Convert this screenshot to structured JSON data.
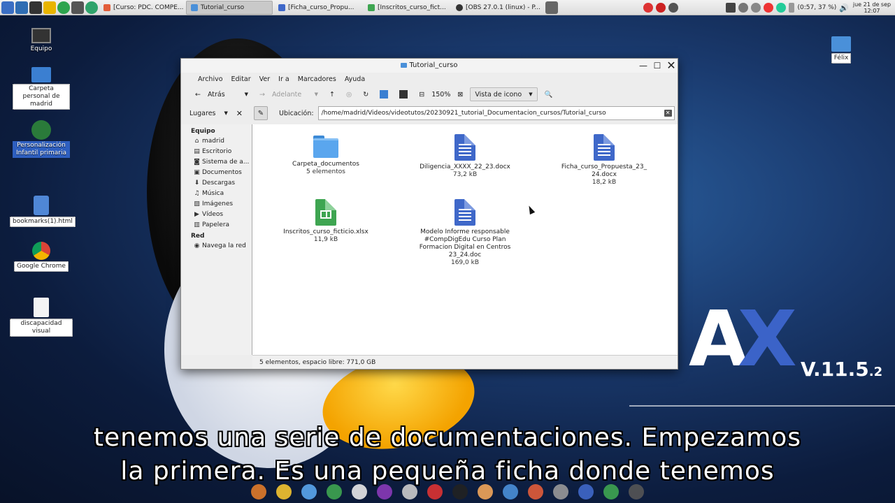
{
  "taskbar": {
    "tasks": [
      {
        "label": "[Curso: PDC. COMPE...",
        "active": false
      },
      {
        "label": "Tutorial_curso",
        "active": true
      },
      {
        "label": "[Ficha_curso_Propu...",
        "active": false
      },
      {
        "label": "[Inscritos_curso_fict...",
        "active": false
      },
      {
        "label": "[OBS 27.0.1 (linux) - P...",
        "active": false
      }
    ],
    "battery": "(0:57, 37 %)",
    "clock_date": "jue 21 de sep",
    "clock_time": "12:07"
  },
  "desktop": {
    "icons": [
      {
        "label": "Equipo"
      },
      {
        "label": "Carpeta personal de madrid"
      },
      {
        "label": "Personalización Infantil primaria"
      },
      {
        "label": "bookmarks(1).html"
      },
      {
        "label": "Google Chrome"
      },
      {
        "label": "discapacidad visual"
      },
      {
        "label": "Félix"
      }
    ]
  },
  "window": {
    "title": "Tutorial_curso",
    "menu": [
      "Archivo",
      "Editar",
      "Ver",
      "Ir a",
      "Marcadores",
      "Ayuda"
    ],
    "toolbar": {
      "back": "Atrás",
      "forward": "Adelante",
      "zoom": "150%",
      "view_mode": "Vista de icono"
    },
    "places_label": "Lugares",
    "location_label": "Ubicación:",
    "location_path": "/home/madrid/Videos/videotutos/20230921_tutorial_Documentacion_cursos/Tutorial_curso",
    "sidebar": {
      "sections": [
        {
          "title": "Equipo",
          "items": [
            {
              "icon": "home-icon",
              "glyph": "⌂",
              "label": "madrid"
            },
            {
              "icon": "desktop-icon",
              "glyph": "▤",
              "label": "Escritorio"
            },
            {
              "icon": "filesystem-icon",
              "glyph": "◙",
              "label": "Sistema de a..."
            },
            {
              "icon": "documents-icon",
              "glyph": "▣",
              "label": "Documentos"
            },
            {
              "icon": "download-icon",
              "glyph": "⬇",
              "label": "Descargas"
            },
            {
              "icon": "music-icon",
              "glyph": "♫",
              "label": "Música"
            },
            {
              "icon": "pictures-icon",
              "glyph": "▨",
              "label": "Imágenes"
            },
            {
              "icon": "videos-icon",
              "glyph": "▶",
              "label": "Vídeos"
            },
            {
              "icon": "trash-icon",
              "glyph": "▥",
              "label": "Papelera"
            }
          ]
        },
        {
          "title": "Red",
          "items": [
            {
              "icon": "network-icon",
              "glyph": "◉",
              "label": "Navega la red"
            }
          ]
        }
      ]
    },
    "files": [
      {
        "type": "folder",
        "name": "Carpeta_documentos",
        "size": "5 elementos"
      },
      {
        "type": "doc",
        "name": "Diligencia_XXXX_22_23.docx",
        "size": "73,2 kB"
      },
      {
        "type": "doc",
        "name": "Ficha_curso_Propuesta_23_ 24.docx",
        "size": "18,2 kB"
      },
      {
        "type": "xls",
        "name": "Inscritos_curso_ficticio.xlsx",
        "size": "11,9 kB"
      },
      {
        "type": "doc",
        "name": "Modelo Informe responsable #CompDigEdu Curso Plan Formacion Digital en Centros 23_24.doc",
        "size": "169,0 kB"
      }
    ],
    "status": "5 elementos, espacio libre: 771,0 GB"
  },
  "branding": {
    "letter_a": "A",
    "letter_x": "X",
    "version": "V.11.5",
    "version_minor": ".2"
  },
  "subtitles": {
    "line1": "tenemos una serie de documentaciones. Empezamos",
    "line2": "la primera. Es una pequeña ficha donde tenemos"
  }
}
